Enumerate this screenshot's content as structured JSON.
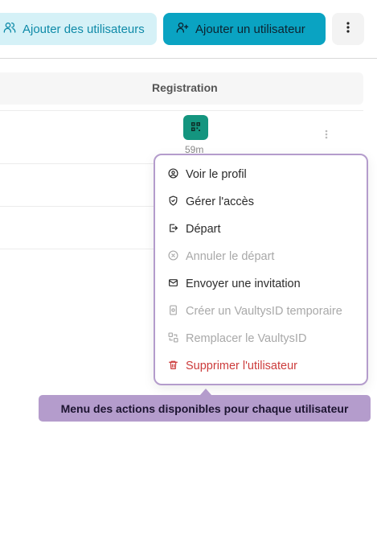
{
  "toolbar": {
    "add_users_label": "Ajouter des utilisateurs",
    "add_user_label": "Ajouter un utilisateur"
  },
  "table": {
    "column_registration": "Registration",
    "row_time": "59m"
  },
  "menu": {
    "items": [
      {
        "label": "Voir le profil",
        "state": "enabled"
      },
      {
        "label": "Gérer l'accès",
        "state": "enabled"
      },
      {
        "label": "Départ",
        "state": "enabled"
      },
      {
        "label": "Annuler le départ",
        "state": "disabled"
      },
      {
        "label": "Envoyer une invitation",
        "state": "enabled"
      },
      {
        "label": "Créer un VaultysID temporaire",
        "state": "disabled"
      },
      {
        "label": "Remplacer le VaultysID",
        "state": "disabled"
      },
      {
        "label": "Supprimer l'utilisateur",
        "state": "danger"
      }
    ]
  },
  "tooltip": {
    "text": "Menu des actions disponibles pour chaque utilisateur"
  },
  "colors": {
    "primary": "#0aa3c2",
    "primary_light": "#d5f1f7",
    "accent_purple": "#b49ccc",
    "qr_green": "#14957f",
    "danger": "#cc3b3b"
  }
}
